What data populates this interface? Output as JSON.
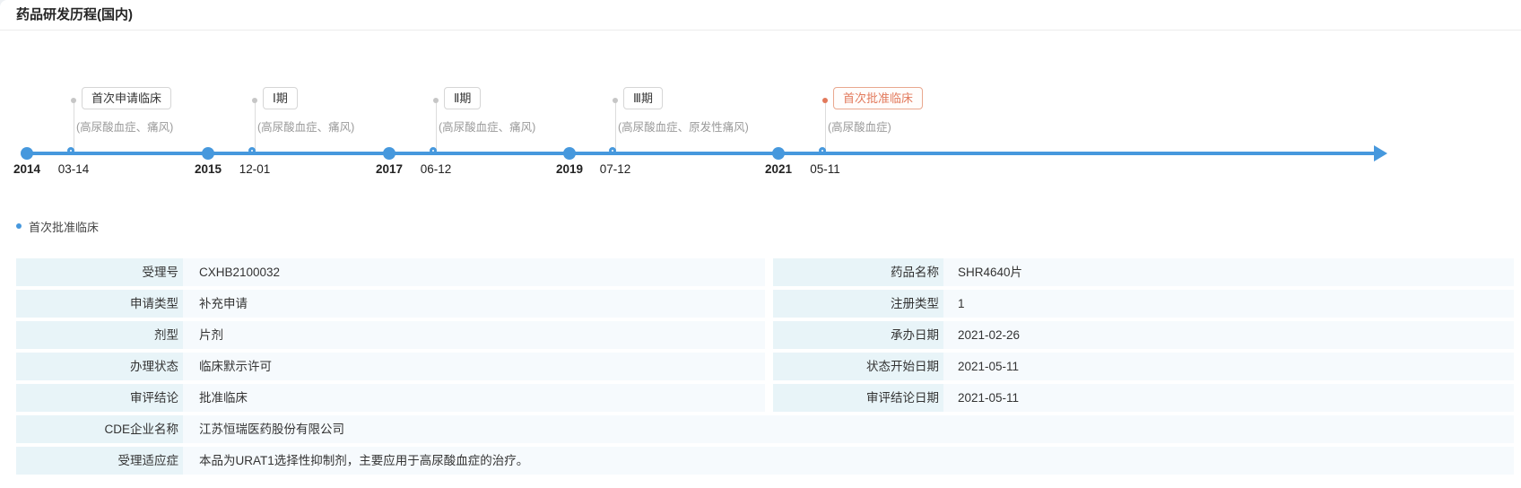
{
  "colors": {
    "accent": "#4698dd",
    "active": "#e2795b"
  },
  "header": {
    "title": "药品研发历程(国内)"
  },
  "timeline": {
    "milestones": [
      {
        "year": "2014",
        "date": "03-14",
        "label": "首次申请临床",
        "indication": "(高尿酸血症、痛风)",
        "active": false
      },
      {
        "year": "2015",
        "date": "12-01",
        "label": "Ⅰ期",
        "indication": "(高尿酸血症、痛风)",
        "active": false
      },
      {
        "year": "2017",
        "date": "06-12",
        "label": "Ⅱ期",
        "indication": "(高尿酸血症、痛风)",
        "active": false
      },
      {
        "year": "2019",
        "date": "07-12",
        "label": "Ⅲ期",
        "indication": "(高尿酸血症、原发性痛风)",
        "active": false
      },
      {
        "year": "2021",
        "date": "05-11",
        "label": "首次批准临床",
        "indication": "(高尿酸血症)",
        "active": true
      }
    ]
  },
  "detail": {
    "selected_label": "首次批准临床",
    "paired_rows": [
      {
        "left_label": "受理号",
        "left_value": "CXHB2100032",
        "right_label": "药品名称",
        "right_value": "SHR4640片"
      },
      {
        "left_label": "申请类型",
        "left_value": "补充申请",
        "right_label": "注册类型",
        "right_value": "1"
      },
      {
        "left_label": "剂型",
        "left_value": "片剂",
        "right_label": "承办日期",
        "right_value": "2021-02-26"
      },
      {
        "left_label": "办理状态",
        "left_value": "临床默示许可",
        "right_label": "状态开始日期",
        "right_value": "2021-05-11"
      },
      {
        "left_label": "审评结论",
        "left_value": "批准临床",
        "right_label": "审评结论日期",
        "right_value": "2021-05-11"
      }
    ],
    "full_rows": [
      {
        "label": "CDE企业名称",
        "value": "江苏恒瑞医药股份有限公司"
      },
      {
        "label": "受理适应症",
        "value": "本品为URAT1选择性抑制剂，主要应用于高尿酸血症的治疗。"
      }
    ]
  }
}
